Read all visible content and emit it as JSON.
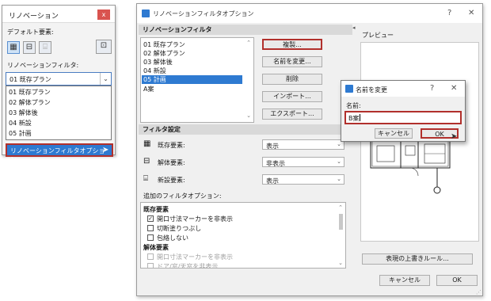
{
  "palette": {
    "title": "リノベーション",
    "close": "x",
    "default_label": "デフォルト要素:",
    "filter_label": "リノベーションフィルタ:",
    "selected_filter": "01 既存プラン",
    "filter_options": [
      "01 既存プラン",
      "02 解体プラン",
      "03 解体後",
      "04 新設",
      "05 計画"
    ],
    "options_button": "リノベーションフィルタオプション..."
  },
  "dialog": {
    "title": "リノベーションフィルタオプション",
    "help": "?",
    "close": "✕",
    "filter_section": "リノベーションフィルタ",
    "filters": [
      "01 既存プラン",
      "02 解体プラン",
      "03 解体後",
      "04 新設",
      "05 計画",
      "A案"
    ],
    "selected_filter_index": 4,
    "buttons": {
      "duplicate": "複製...",
      "rename": "名前を変更...",
      "delete": "削除",
      "import": "インポート...",
      "export": "エクスポート..."
    },
    "preview_label": "プレビュー",
    "settings_section": "フィルタ設定",
    "settings_rows": [
      {
        "label": "既存要素:",
        "value": "表示"
      },
      {
        "label": "解体要素:",
        "value": "非表示"
      },
      {
        "label": "新設要素:",
        "value": "表示"
      }
    ],
    "additional_label": "追加のフィルタオプション:",
    "existing_group": "既存要素",
    "existing_options": [
      {
        "label": "開口寸法マーカーを非表示",
        "checked": true
      },
      {
        "label": "切断塗りつぶし",
        "checked": false
      },
      {
        "label": "包絡しない",
        "checked": false
      }
    ],
    "demolished_group": "解体要素",
    "demolished_options": [
      {
        "label": "開口寸法マーカーを非表示",
        "checked": false
      },
      {
        "label": "ドア/窓/天窓を非表示",
        "checked": false
      }
    ],
    "override_button": "表現の上書きルール...",
    "cancel": "キャンセル",
    "ok": "OK"
  },
  "rename_dialog": {
    "title": "名前を変更",
    "help": "?",
    "close": "✕",
    "name_label": "名前:",
    "name_value": "B案",
    "cancel": "キャンセル",
    "ok": "OK"
  },
  "colors": {
    "accent_blue": "#2e7ad1",
    "highlight_red": "#b1302c"
  }
}
